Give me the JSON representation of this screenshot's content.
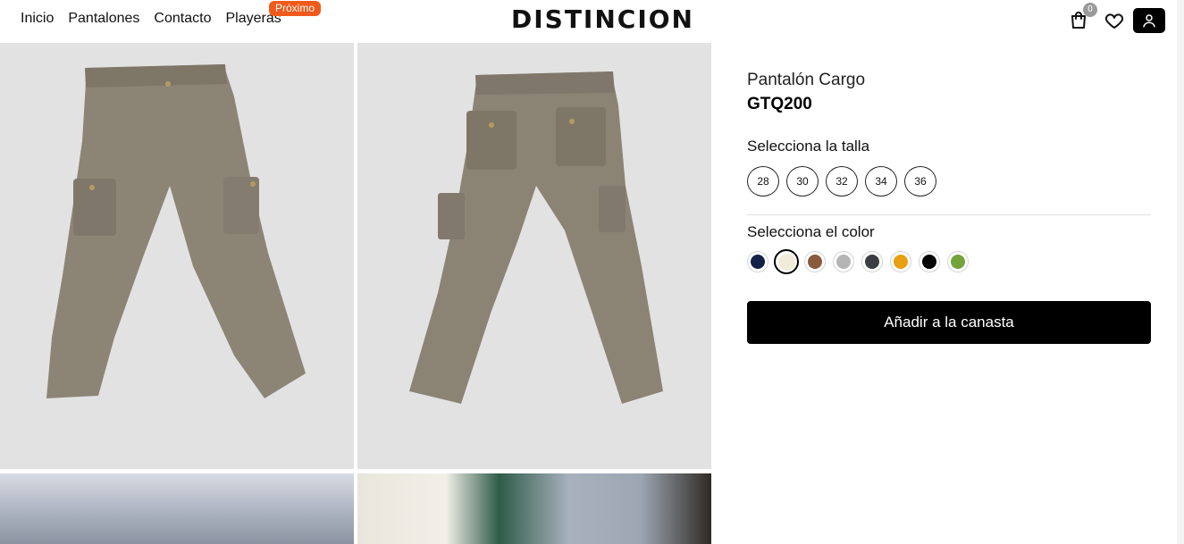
{
  "header": {
    "nav": [
      {
        "label": "Inicio"
      },
      {
        "label": "Pantalones"
      },
      {
        "label": "Contacto"
      },
      {
        "label": "Playeras"
      }
    ],
    "nav_badge": "Próximo",
    "brand": "DISTINCION",
    "cart_count": "0",
    "icons": [
      "cart-icon",
      "heart-icon",
      "user-icon"
    ]
  },
  "product": {
    "name": "Pantalón Cargo",
    "price": "GTQ200",
    "size_label": "Selecciona la talla",
    "sizes": [
      "28",
      "30",
      "32",
      "34",
      "36"
    ],
    "color_label": "Selecciona el color",
    "colors": [
      {
        "name": "navy",
        "hex": "#13214a"
      },
      {
        "name": "cream",
        "hex": "#f1ecd9",
        "selected": true
      },
      {
        "name": "brown",
        "hex": "#8a5a3c"
      },
      {
        "name": "light-gray",
        "hex": "#b5b5b5"
      },
      {
        "name": "charcoal",
        "hex": "#3a3d42"
      },
      {
        "name": "mustard",
        "hex": "#e6a010"
      },
      {
        "name": "black",
        "hex": "#000000"
      },
      {
        "name": "olive-green",
        "hex": "#74a33d"
      }
    ],
    "add_to_cart": "Añadir a la canasta"
  },
  "gallery": {
    "images": [
      "pants-front-photo",
      "pants-back-photo",
      "model-photo-1",
      "model-photo-2"
    ]
  }
}
